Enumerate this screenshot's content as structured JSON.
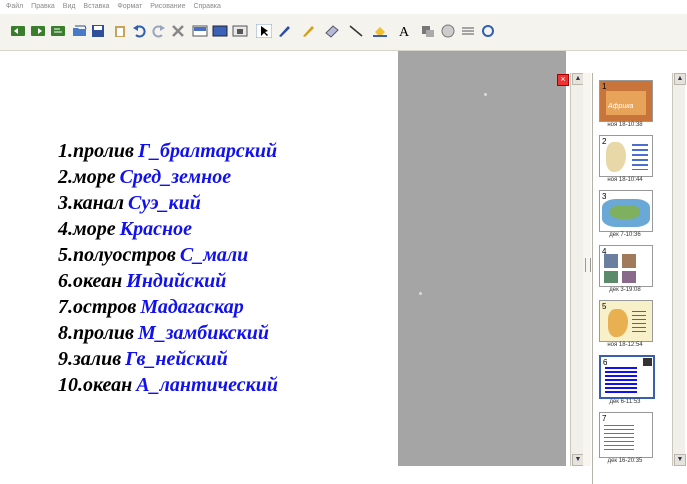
{
  "menu": [
    "Файл",
    "Правка",
    "Вид",
    "Вставка",
    "Формат",
    "Рисование",
    "Справка"
  ],
  "toolbar_icons": [
    "back-icon",
    "forward-icon",
    "forward-page-icon",
    "open-icon",
    "save-icon",
    "paste-icon",
    "undo-icon",
    "redo-icon",
    "delete-icon",
    "screen-shade-icon",
    "full-screen-icon",
    "capture-icon",
    "select-icon",
    "pen-icon",
    "creative-pen-icon",
    "eraser-icon",
    "line-icon",
    "fill-icon",
    "text-icon",
    "move-icon",
    "gallery-icon",
    "menu-more-icon",
    "refresh-icon"
  ],
  "slide": {
    "lines": [
      {
        "num": "1.",
        "word": "пролив",
        "answer": "Г_бралтарский"
      },
      {
        "num": "2.",
        "word": "море",
        "answer": "Сред_земное"
      },
      {
        "num": "3.",
        "word": "канал",
        "answer": "Суэ_кий"
      },
      {
        "num": "4.",
        "word": "море",
        "answer": "Красное"
      },
      {
        "num": "5.",
        "word": "полуостров",
        "answer": "С_мали"
      },
      {
        "num": "6.",
        "word": "океан",
        "answer": "Индийский"
      },
      {
        "num": "7.",
        "word": "остров",
        "answer": "Мадагаскар"
      },
      {
        "num": "8.",
        "word": "пролив",
        "answer": "М_замбикский"
      },
      {
        "num": "9.",
        "word": "залив",
        "answer": "Гв_нейский"
      },
      {
        "num": "10.",
        "word": "океан",
        "answer": "А_лантический"
      }
    ]
  },
  "close_label": "×",
  "thumbnails": [
    {
      "num": "1",
      "label": "ноя 18-10:38",
      "title": "Африка"
    },
    {
      "num": "2",
      "label": "ноя 18-10:44",
      "title": ""
    },
    {
      "num": "3",
      "label": "дек 7-10:36",
      "title": ""
    },
    {
      "num": "4",
      "label": "дек 3-19:08",
      "title": ""
    },
    {
      "num": "5",
      "label": "ноя 18-12:54",
      "title": ""
    },
    {
      "num": "6",
      "label": "дек 6-11:53",
      "title": ""
    },
    {
      "num": "7",
      "label": "дек 16-20:35",
      "title": ""
    }
  ],
  "colors": {
    "answer": "#1111ee",
    "grey_pane": "#a5a5a5",
    "toolbar_bg": "#f4f3ee"
  }
}
